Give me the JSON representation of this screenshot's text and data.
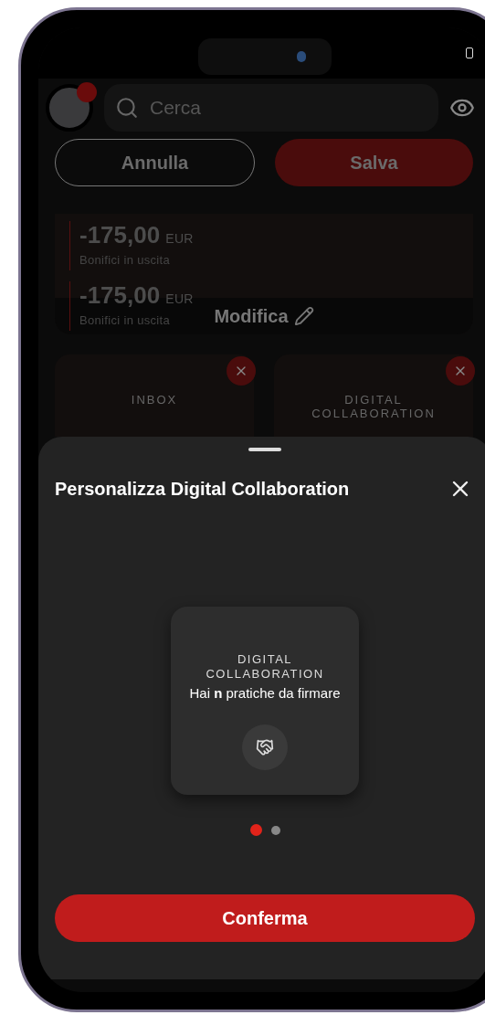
{
  "search": {
    "placeholder": "Cerca"
  },
  "buttons": [
    {
      "label": "Annulla",
      "kind": "outline"
    },
    {
      "label": "Salva",
      "kind": "primary"
    }
  ],
  "transactions": [
    {
      "amount": "-175,00",
      "currency": "EUR",
      "label": "Bonifici in uscita"
    },
    {
      "amount": "-175,00",
      "currency": "EUR",
      "label": "Bonifici in uscita"
    }
  ],
  "edit_label": "Modifica",
  "widgets": [
    {
      "title": "INBOX"
    },
    {
      "title": "DIGITAL COLLABORATION"
    }
  ],
  "sheet": {
    "title": "Personalizza Digital Collaboration",
    "preview": {
      "title": "DIGITAL COLLABORATION",
      "text": "Hai **n** pratiche da firmare"
    },
    "pages": [
      {
        "selected": true
      },
      {
        "selected": false
      }
    ],
    "confirm": "Conferma"
  }
}
